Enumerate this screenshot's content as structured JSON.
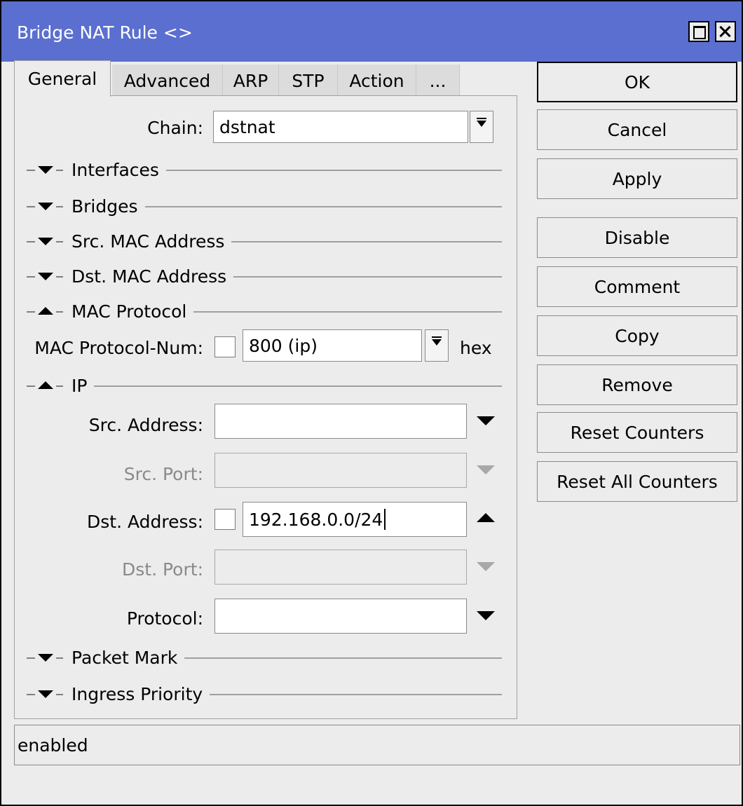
{
  "window": {
    "title": "Bridge NAT Rule <>"
  },
  "tabs": [
    "General",
    "Advanced",
    "ARP",
    "STP",
    "Action",
    "..."
  ],
  "general": {
    "chain": {
      "label": "Chain:",
      "value": "dstnat"
    },
    "sections": {
      "interfaces": "Interfaces",
      "bridges": "Bridges",
      "src_mac": "Src. MAC Address",
      "dst_mac": "Dst. MAC Address",
      "mac_protocol": "MAC Protocol",
      "ip": "IP",
      "packet_mark": "Packet Mark",
      "ingress_priority": "Ingress Priority"
    },
    "mac_protocol_num": {
      "label": "MAC Protocol-Num:",
      "value": "800 (ip)",
      "suffix": "hex",
      "negate": false
    },
    "src_address": {
      "label": "Src. Address:",
      "value": ""
    },
    "src_port": {
      "label": "Src. Port:",
      "value": ""
    },
    "dst_address": {
      "label": "Dst. Address:",
      "value": "192.168.0.0/24",
      "negate": false
    },
    "dst_port": {
      "label": "Dst. Port:",
      "value": ""
    },
    "protocol": {
      "label": "Protocol:",
      "value": ""
    }
  },
  "buttons": [
    "OK",
    "Cancel",
    "Apply",
    "Disable",
    "Comment",
    "Copy",
    "Remove",
    "Reset Counters",
    "Reset All Counters"
  ],
  "status": {
    "text": "enabled"
  }
}
